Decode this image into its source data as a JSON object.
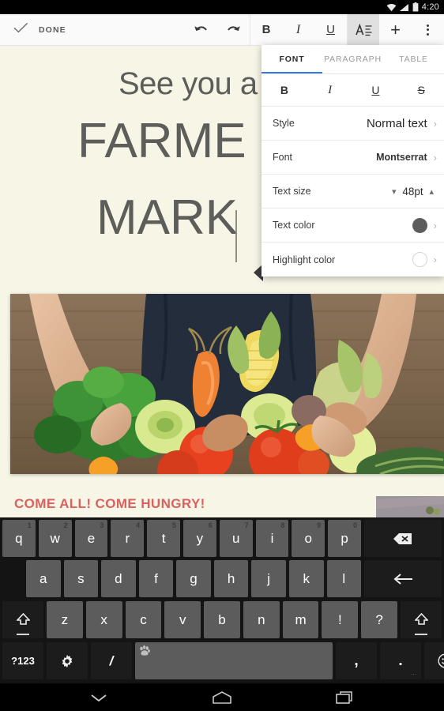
{
  "status_bar": {
    "time": "4:20",
    "icons": [
      "wifi-icon",
      "cellular-signal-icon",
      "battery-icon"
    ]
  },
  "toolbar": {
    "done_label": "DONE",
    "check_icon": "check-icon",
    "buttons": [
      {
        "name": "undo-button",
        "icon": "undo-icon"
      },
      {
        "name": "redo-button",
        "icon": "redo-icon"
      },
      {
        "name": "bold-button",
        "label": "B"
      },
      {
        "name": "italic-button",
        "label": "I"
      },
      {
        "name": "underline-button",
        "label": "U"
      },
      {
        "name": "format-button",
        "icon": "text-format-icon",
        "active": true
      },
      {
        "name": "insert-button",
        "label": "+"
      },
      {
        "name": "overflow-menu-button",
        "icon": "kebab-menu-icon"
      }
    ]
  },
  "document": {
    "background_color": "#f7f5e6",
    "text_color": "#5d5d5a",
    "line_subtitle": "See you a",
    "line_heading_1": "FARME",
    "line_heading_2": "MARK",
    "cta_text": "COME ALL! COME HUNGRY!",
    "cta_color": "#d9625f",
    "photo_alt": "farmer-holding-vegetables-photo"
  },
  "format_panel": {
    "tabs": [
      {
        "label": "FONT",
        "active": true
      },
      {
        "label": "PARAGRAPH",
        "active": false
      },
      {
        "label": "TABLE",
        "active": false
      }
    ],
    "accent_color": "#3b78e7",
    "style_buttons": [
      {
        "name": "panel-bold-button",
        "label": "B"
      },
      {
        "name": "panel-italic-button",
        "label": "I"
      },
      {
        "name": "panel-underline-button",
        "label": "U"
      },
      {
        "name": "panel-strikethrough-button",
        "label": "S"
      }
    ],
    "rows": {
      "style": {
        "label": "Style",
        "value": "Normal text"
      },
      "font": {
        "label": "Font",
        "value": "Montserrat"
      },
      "text_size": {
        "label": "Text size",
        "value": "48pt"
      },
      "text_color": {
        "label": "Text color",
        "value_color": "#5d5d5d"
      },
      "highlight_color": {
        "label": "Highlight color",
        "value_color": "#ffffff"
      }
    }
  },
  "keyboard": {
    "row1": [
      {
        "key": "q",
        "hint": "1"
      },
      {
        "key": "w",
        "hint": "2"
      },
      {
        "key": "e",
        "hint": "3"
      },
      {
        "key": "r",
        "hint": "4"
      },
      {
        "key": "t",
        "hint": "5"
      },
      {
        "key": "y",
        "hint": "6"
      },
      {
        "key": "u",
        "hint": "7"
      },
      {
        "key": "i",
        "hint": "8"
      },
      {
        "key": "o",
        "hint": "9"
      },
      {
        "key": "p",
        "hint": "0"
      }
    ],
    "row2": [
      "a",
      "s",
      "d",
      "f",
      "g",
      "h",
      "j",
      "k",
      "l"
    ],
    "row3": [
      "z",
      "x",
      "c",
      "v",
      "b",
      "n",
      "m",
      "!",
      "?"
    ],
    "row4": {
      "symbols_label": "?123",
      "settings_icon": "gear-icon",
      "slash_label": "/",
      "space_icon": "paw-print-icon",
      "comma_label": ",",
      "period_label": ".",
      "emoji_icon": "smiley-icon"
    },
    "backspace_icon": "backspace-icon",
    "enter_icon": "enter-arrow-icon",
    "shift_icon": "shift-arrow-icon"
  },
  "nav_bar": {
    "back_icon": "chevron-down-icon",
    "home_icon": "home-icon",
    "recents_icon": "recent-apps-icon"
  }
}
